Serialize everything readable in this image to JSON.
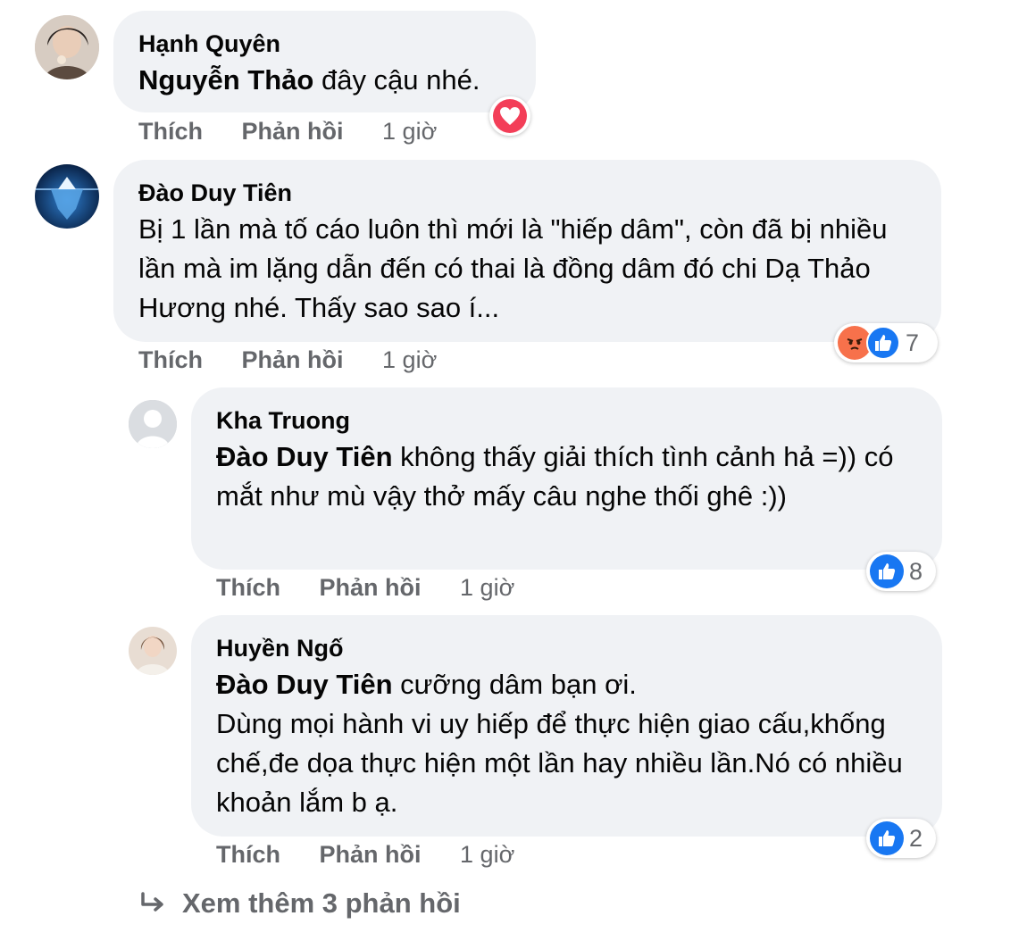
{
  "actions": {
    "like": "Thích",
    "reply": "Phản hồi"
  },
  "comments": [
    {
      "author": "Hạnh Quyên",
      "mention": "Nguyễn Thảo",
      "text": " đây cậu nhé.",
      "time": "1 giờ",
      "reactions": [
        "love-icon"
      ],
      "reaction_count": ""
    },
    {
      "author": "Đào Duy Tiên",
      "mention": "",
      "text": "Bị 1 lần mà tố cáo luôn thì mới là \"hiếp dâm\", còn đã bị nhiều lần mà im lặng dẫn đến có thai là đồng dâm đó chi Dạ Thảo Hương nhé. Thấy sao sao í...",
      "time": "1 giờ",
      "reactions": [
        "angry-icon",
        "like-icon"
      ],
      "reaction_count": "7"
    },
    {
      "author": "Kha Truong",
      "mention": "Đào Duy Tiên",
      "text": " không thấy giải thích tình cảnh hả =)) có mắt như mù vậy thở mấy câu nghe thối ghê :))",
      "time": "1 giờ",
      "reactions": [
        "like-icon"
      ],
      "reaction_count": "8"
    },
    {
      "author": "Huyền Ngố",
      "mention": "Đào Duy Tiên",
      "text": " cưỡng dâm bạn ơi.\nDùng mọi hành vi uy hiếp để thực hiện giao cấu,khống chế,đe dọa thực hiện một lần hay nhiều lần.Nó có nhiều khoản lắm b ạ.",
      "time": "1 giờ",
      "reactions": [
        "like-icon"
      ],
      "reaction_count": "2"
    }
  ],
  "see_more": "Xem thêm 3 phản hồi",
  "colors": {
    "bubble": "#f0f2f5",
    "muted": "#65676b",
    "like_blue": "#1877f2",
    "love_red": "#f33e58",
    "angry_orange": "#f7714b"
  }
}
